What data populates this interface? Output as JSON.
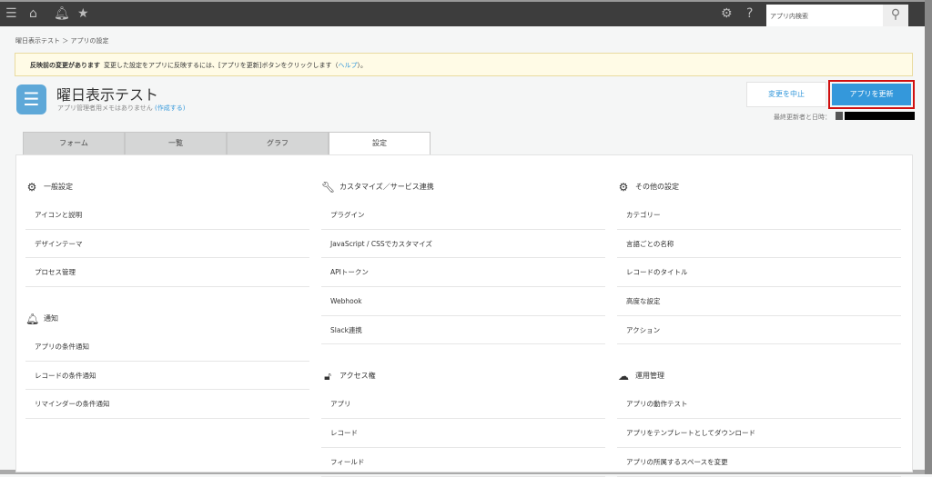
{
  "topbar": {
    "search_placeholder": "アプリ内検索"
  },
  "breadcrumb": "曜日表示テスト ＞ アプリの設定",
  "notice": {
    "bold": "反映前の変更があります",
    "text": "変更した設定をアプリに反映するには、[アプリを更新]ボタンをクリックします（",
    "link": "ヘルプ",
    "tail": "）。"
  },
  "app": {
    "title": "曜日表示テスト",
    "memo": "アプリ管理者用メモはありません",
    "memo_link": "(作成する)"
  },
  "buttons": {
    "cancel": "変更を中止",
    "update": "アプリを更新"
  },
  "update_info": "最終更新者と日時：",
  "tabs": [
    "フォーム",
    "一覧",
    "グラフ",
    "設定"
  ],
  "columns": [
    {
      "sections": [
        {
          "title": "一般設定",
          "icon": "gear",
          "items": [
            "アイコンと説明",
            "デザインテーマ",
            "プロセス管理"
          ]
        },
        {
          "title": "通知",
          "icon": "bell",
          "items": [
            "アプリの条件通知",
            "レコードの条件通知",
            "リマインダーの条件通知"
          ]
        }
      ]
    },
    {
      "sections": [
        {
          "title": "カスタマイズ／サービス連携",
          "icon": "wrench",
          "items": [
            "プラグイン",
            "JavaScript / CSSでカスタマイズ",
            "APIトークン",
            "Webhook",
            "Slack連携"
          ]
        },
        {
          "title": "アクセス権",
          "icon": "lock",
          "items": [
            "アプリ",
            "レコード",
            "フィールド"
          ]
        }
      ]
    },
    {
      "sections": [
        {
          "title": "その他の設定",
          "icon": "gears",
          "items": [
            "カテゴリー",
            "言語ごとの名称",
            "レコードのタイトル",
            "高度な設定",
            "アクション"
          ]
        },
        {
          "title": "運用管理",
          "icon": "cloud",
          "items": [
            "アプリの動作テスト",
            "アプリをテンプレートとしてダウンロード",
            "アプリの所属するスペースを変更"
          ]
        }
      ]
    }
  ]
}
